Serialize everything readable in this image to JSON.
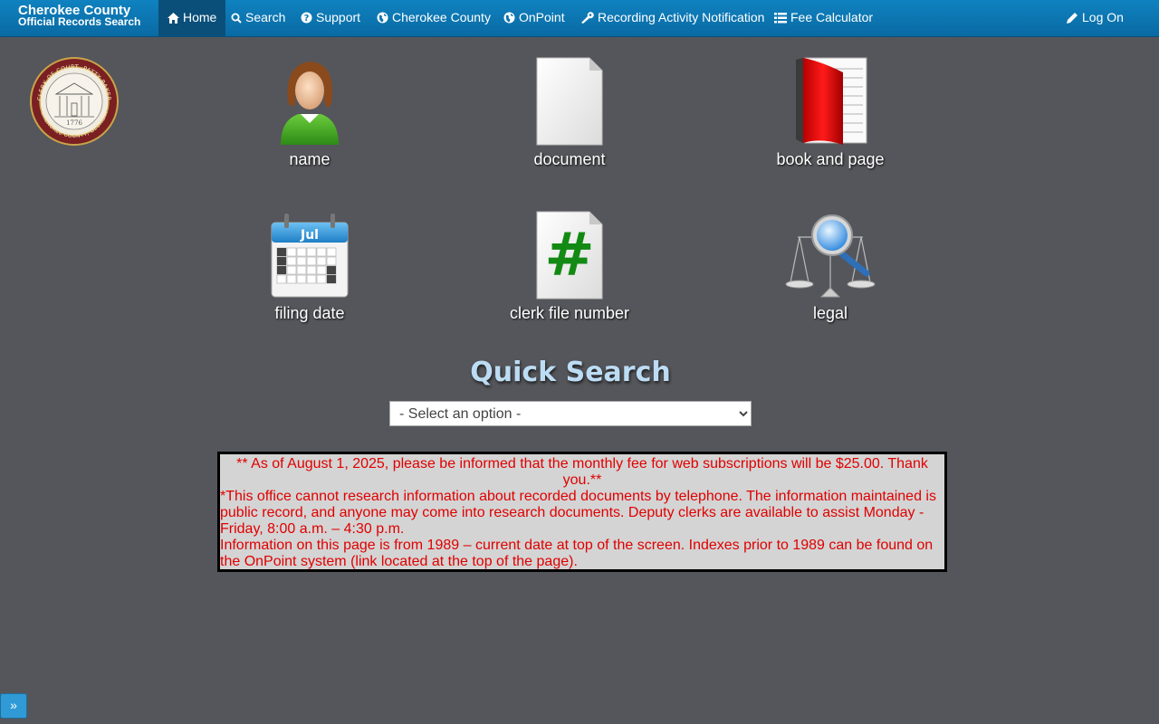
{
  "brand": {
    "line1": "Cherokee County",
    "line2": "Official Records Search"
  },
  "nav": {
    "home": "Home",
    "search": "Search",
    "support": "Support",
    "county": "Cherokee County",
    "onpoint": "OnPoint",
    "notification": "Recording Activity Notification",
    "fee": "Fee Calculator",
    "logon": "Log On"
  },
  "seal": {
    "text_top": "CLERK OF COURT, PATTY BAKER",
    "text_bottom": "CHEROKEE COUNTY, GEORGIA",
    "year": "1776"
  },
  "tiles": {
    "name": "name",
    "document": "document",
    "book": "book and page",
    "filing": "filing date",
    "clerk": "clerk file number",
    "legal": "legal"
  },
  "calendar_month": "Jul",
  "clerk_symbol": "#",
  "quick_search": {
    "title": "Quick Search",
    "selected": "- Select an option -"
  },
  "notice": {
    "line1": " ** As of August 1, 2025, please be informed that the monthly fee for web subscriptions will be $25.00. Thank you.**",
    "line2": "*This office cannot research information about recorded documents by telephone. The information maintained is public record, and anyone may come into research documents. Deputy clerks are available to assist Monday - Friday, 8:00 a.m. – 4:30 p.m.",
    "line3": "Information on this page is from 1989 – current date at top of the screen. Indexes prior to 1989 can be found on the OnPoint system (link located at the top of the page)."
  },
  "expander": "»",
  "colors": {
    "nav": "#0f82c0",
    "background": "#55565b",
    "notice_text": "#e00000",
    "qs_title": "#bcdcf4"
  }
}
